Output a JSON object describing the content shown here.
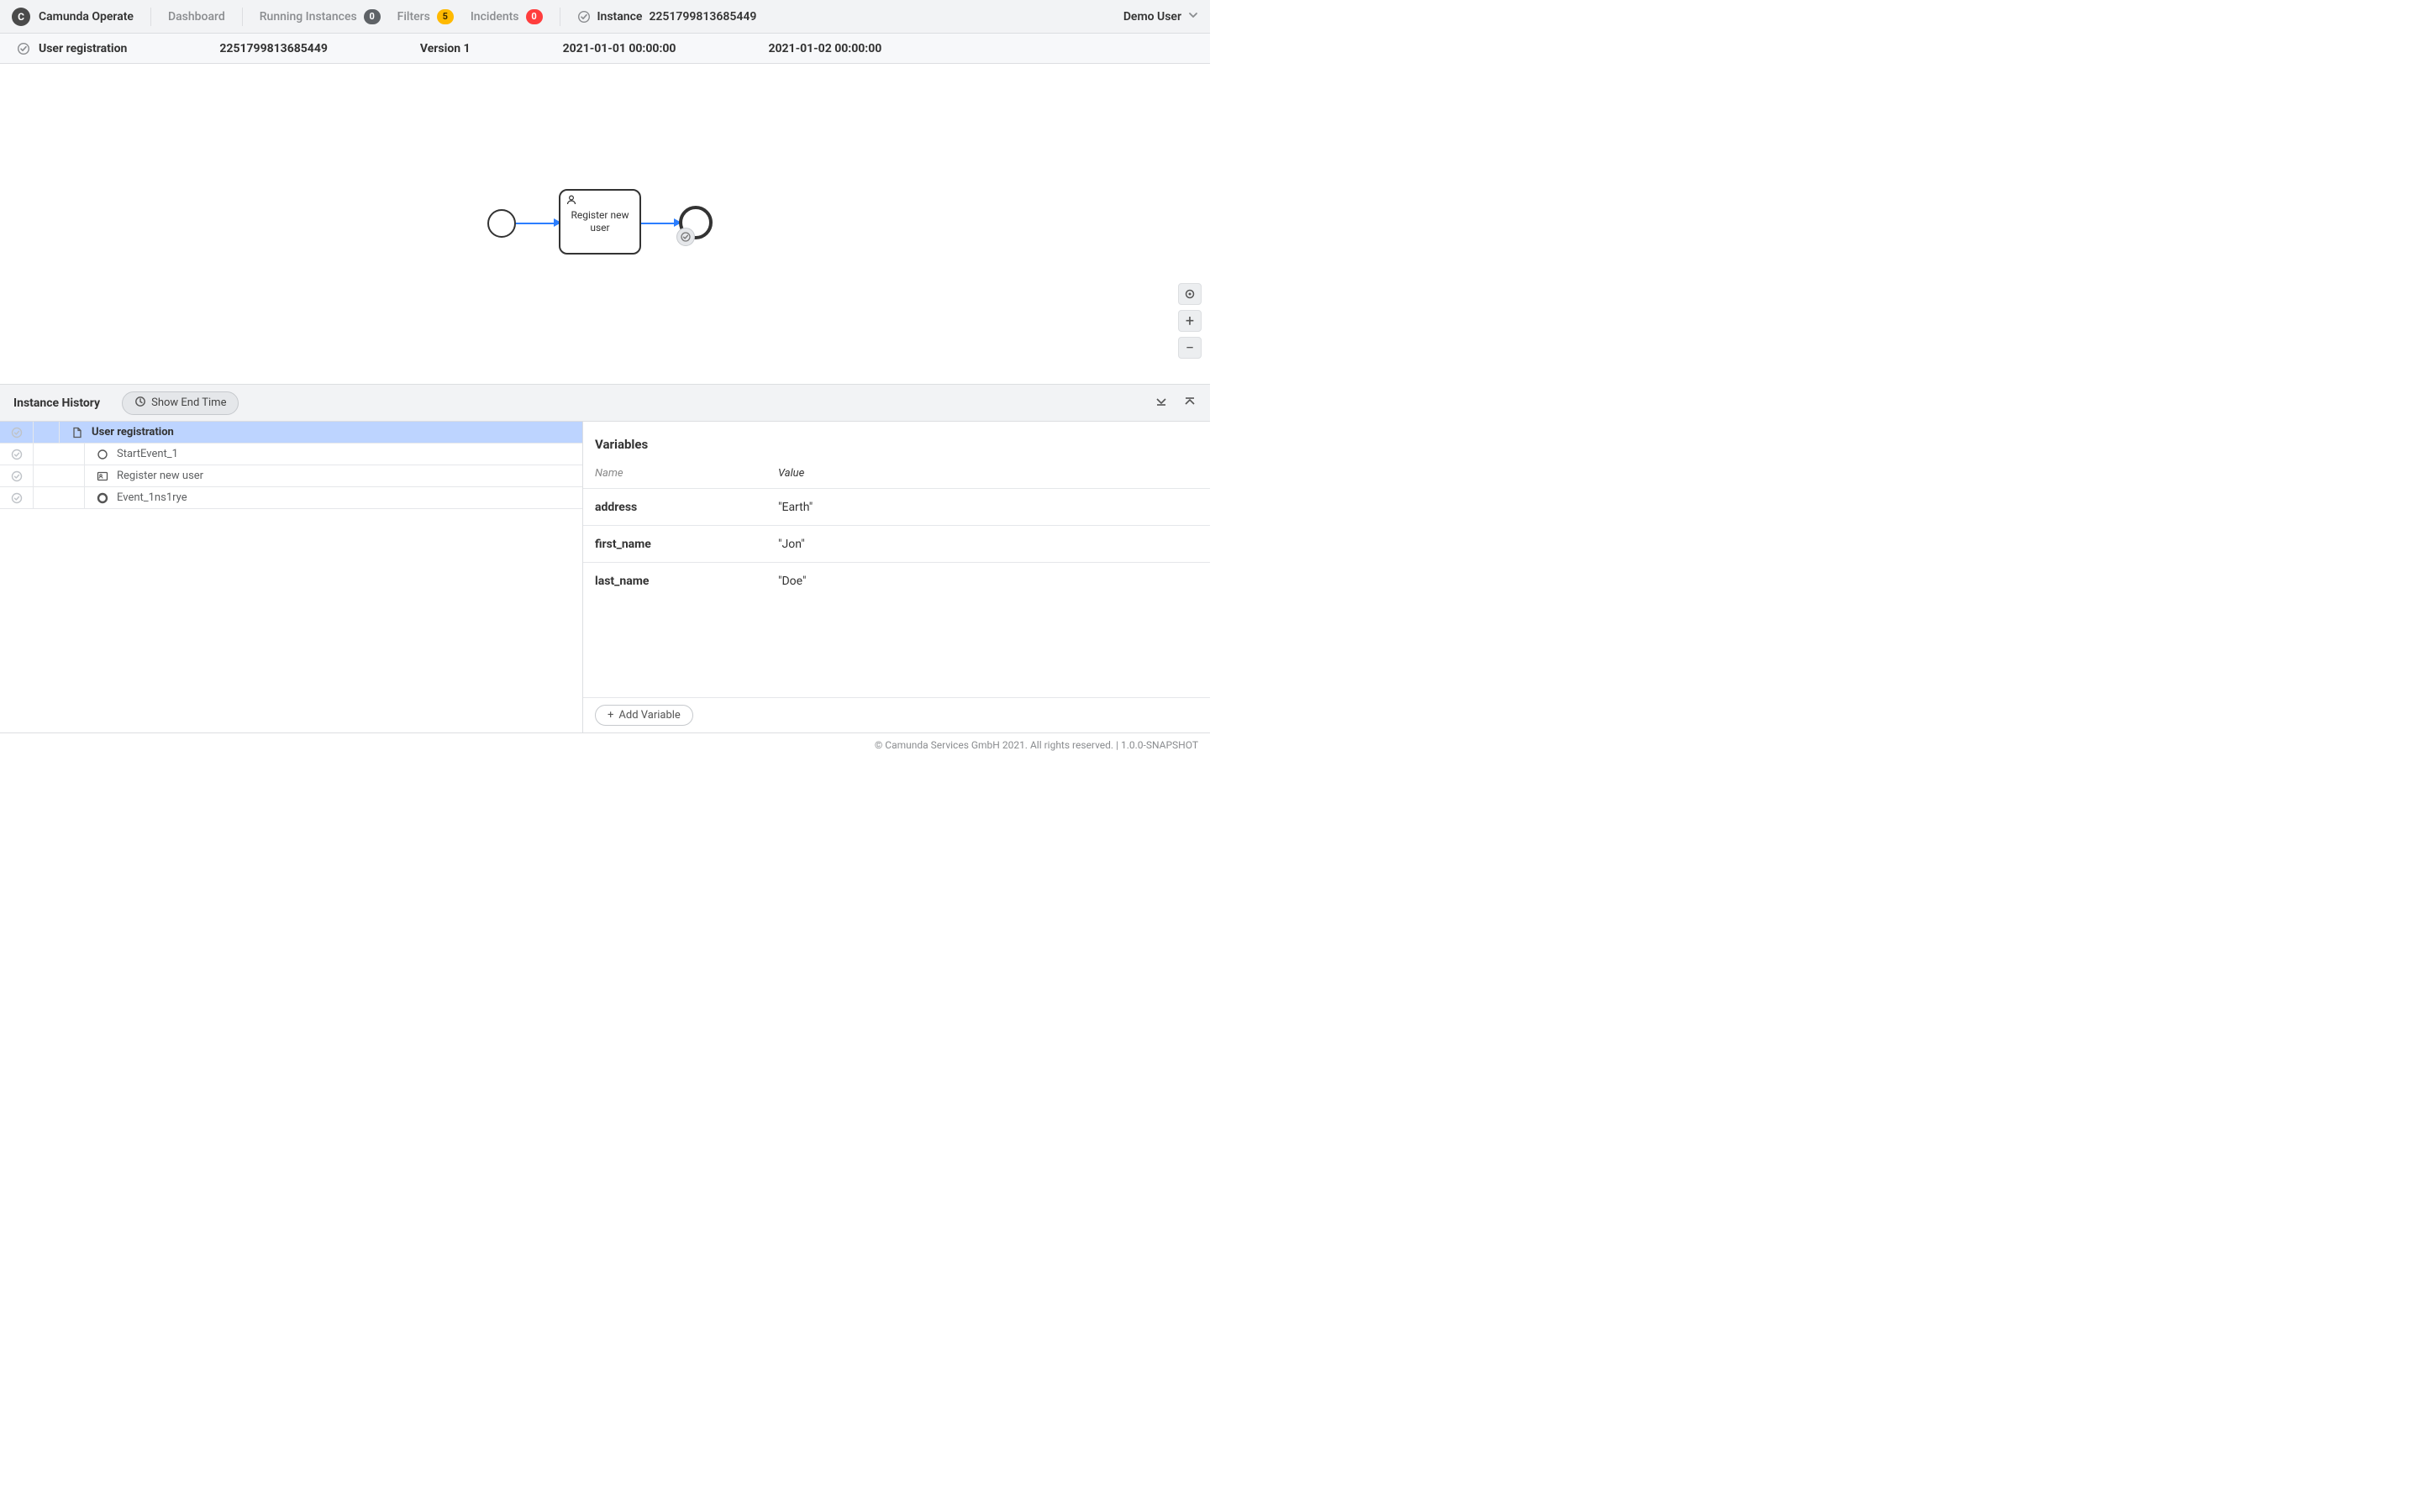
{
  "brand": {
    "logo_letter": "C",
    "name": "Camunda Operate"
  },
  "nav": {
    "dashboard": "Dashboard",
    "running": {
      "label": "Running Instances",
      "count": "0"
    },
    "filters": {
      "label": "Filters",
      "count": "5"
    },
    "incidents": {
      "label": "Incidents",
      "count": "0"
    },
    "instance": {
      "label": "Instance",
      "id": "2251799813685449"
    }
  },
  "user": {
    "name": "Demo User"
  },
  "summary": {
    "name": "User registration",
    "instance_id": "2251799813685449",
    "version": "Version 1",
    "start": "2021-01-01 00:00:00",
    "end": "2021-01-02 00:00:00"
  },
  "bpmn": {
    "task_label": "Register new user"
  },
  "history": {
    "title": "Instance History",
    "show_end_time": "Show End Time",
    "nodes": [
      {
        "label": "User registration",
        "icon": "document",
        "depth": 0,
        "selected": true
      },
      {
        "label": "StartEvent_1",
        "icon": "circle",
        "depth": 1,
        "selected": false
      },
      {
        "label": "Register new user",
        "icon": "task",
        "depth": 1,
        "selected": false
      },
      {
        "label": "Event_1ns1rye",
        "icon": "ring",
        "depth": 1,
        "selected": false
      }
    ]
  },
  "variables": {
    "title": "Variables",
    "columns": {
      "name": "Name",
      "value": "Value"
    },
    "rows": [
      {
        "name": "address",
        "value": "\"Earth\""
      },
      {
        "name": "first_name",
        "value": "\"Jon\""
      },
      {
        "name": "last_name",
        "value": "\"Doe\""
      }
    ],
    "add_label": "Add Variable"
  },
  "footer": "© Camunda Services GmbH 2021. All rights reserved. | 1.0.0-SNAPSHOT"
}
